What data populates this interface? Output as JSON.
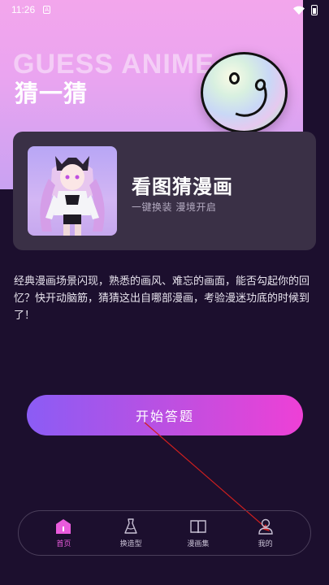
{
  "status_bar": {
    "time": "11:26",
    "notification_glyph": "A"
  },
  "hero": {
    "title_en": "GUESS ANIME",
    "title_cn": "猜一猜"
  },
  "card": {
    "title": "看图猜漫画",
    "subtitle": "一键换装 漫境开启"
  },
  "description": "经典漫画场景闪现，熟悉的画风、难忘的画面，能否勾起你的回忆？快开动脑筋，猜猜这出自哪部漫画，考验漫迷功底的时候到了！",
  "start_button": {
    "label": "开始答题"
  },
  "tabs": [
    {
      "label": "首页",
      "icon": "home-icon",
      "active": true
    },
    {
      "label": "换造型",
      "icon": "dress-icon",
      "active": false
    },
    {
      "label": "漫画集",
      "icon": "book-icon",
      "active": false
    },
    {
      "label": "我的",
      "icon": "profile-icon",
      "active": false
    }
  ],
  "colors": {
    "background": "#1c0f2e",
    "hero_pink": "#f3a6ec",
    "card_bg": "#3a3046",
    "accent_start": "#8b5cf5",
    "accent_end": "#ee40d6",
    "active_tab": "#e95bdc"
  }
}
